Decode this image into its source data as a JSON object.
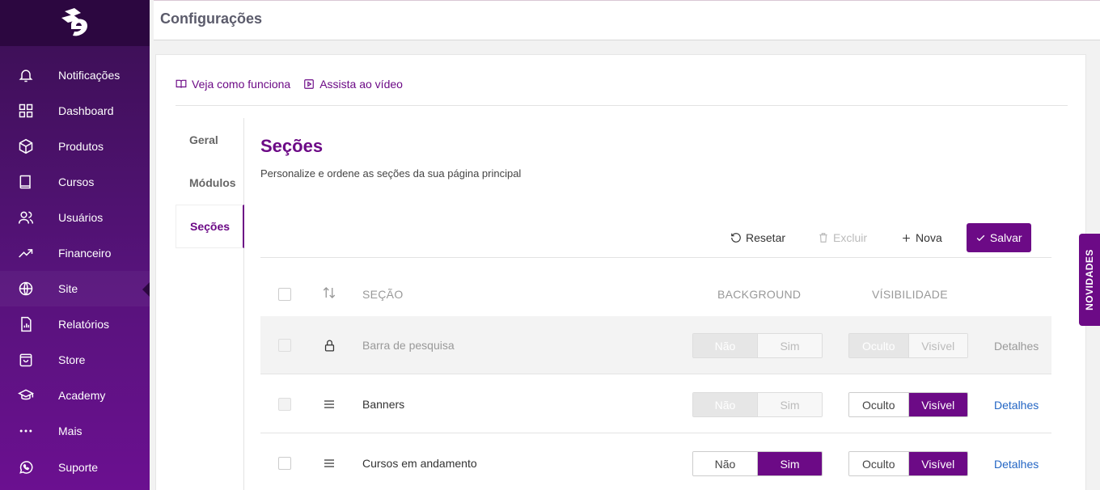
{
  "header": {
    "title": "Configurações"
  },
  "sidebar": {
    "items": [
      {
        "label": "Notificações",
        "icon": "bell-icon"
      },
      {
        "label": "Dashboard",
        "icon": "grid-icon"
      },
      {
        "label": "Produtos",
        "icon": "box-icon"
      },
      {
        "label": "Cursos",
        "icon": "book-icon"
      },
      {
        "label": "Usuários",
        "icon": "users-icon"
      },
      {
        "label": "Financeiro",
        "icon": "trend-icon"
      },
      {
        "label": "Site",
        "icon": "globe-icon"
      },
      {
        "label": "Relatórios",
        "icon": "report-icon"
      },
      {
        "label": "Store",
        "icon": "bag-icon"
      },
      {
        "label": "Academy",
        "icon": "graduation-cap-icon"
      },
      {
        "label": "Mais",
        "icon": "dots-icon"
      },
      {
        "label": "Suporte",
        "icon": "whatsapp-icon"
      }
    ]
  },
  "help": {
    "how_it_works": "Veja como funciona",
    "watch_video": "Assista ao vídeo"
  },
  "subnav": {
    "items": [
      "Geral",
      "Módulos",
      "Seções"
    ],
    "active": "Seções"
  },
  "section": {
    "title": "Seções",
    "description": "Personalize e ordene as seções da sua página principal"
  },
  "toolbar": {
    "reset": "Resetar",
    "delete": "Excluir",
    "new": "Nova",
    "save": "Salvar"
  },
  "table": {
    "headers": {
      "section": "SEÇÃO",
      "background": "BACKGROUND",
      "visibility": "VÍSIBILIDADE"
    },
    "rows": [
      {
        "name": "Barra de pesquisa",
        "bg_no": "Não",
        "bg_yes": "Sim",
        "vis_hidden": "Oculto",
        "vis_visible": "Visível",
        "details": "Detalhes"
      },
      {
        "name": "Banners",
        "bg_no": "Não",
        "bg_yes": "Sim",
        "vis_hidden": "Oculto",
        "vis_visible": "Visível",
        "details": "Detalhes"
      },
      {
        "name": "Cursos em andamento",
        "bg_no": "Não",
        "bg_yes": "Sim",
        "vis_hidden": "Oculto",
        "vis_visible": "Visível",
        "details": "Detalhes"
      }
    ]
  },
  "novidades": "NOVIDADES",
  "colors": {
    "brand": "#6c0a86",
    "link": "#2466c4",
    "sidebar_dark": "#2c0740"
  }
}
